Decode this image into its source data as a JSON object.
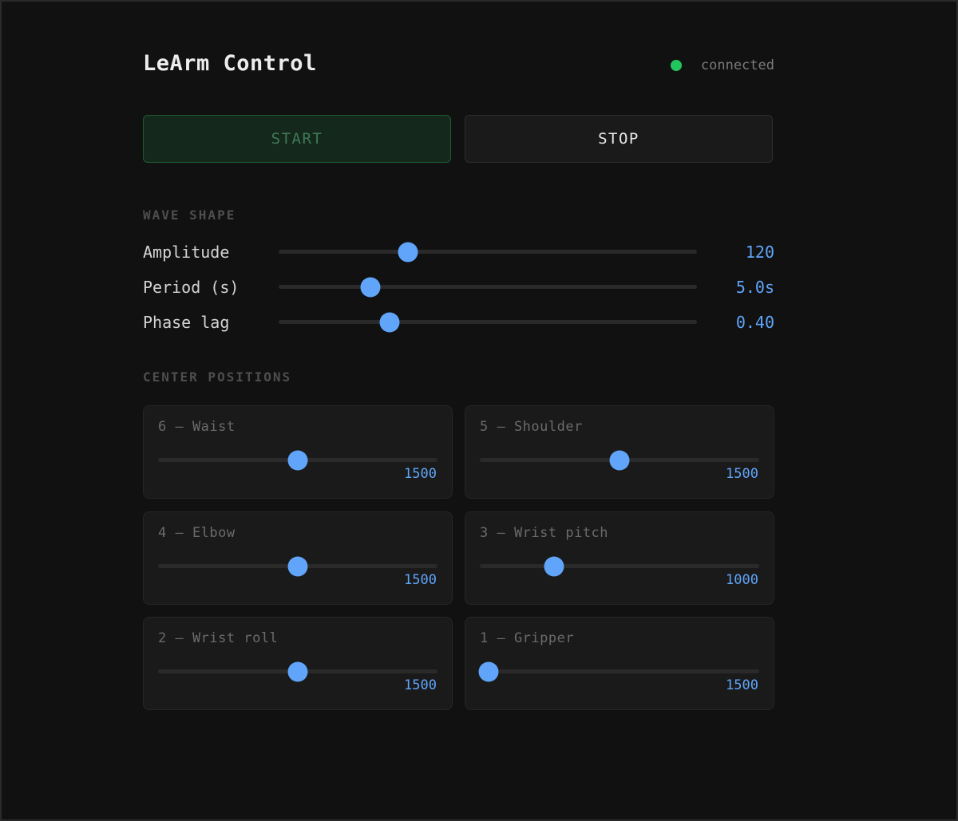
{
  "header": {
    "title": "LeArm Control",
    "status_text": "connected",
    "status_color": "#22c55e"
  },
  "controls": {
    "start_label": "START",
    "stop_label": "STOP"
  },
  "wave_shape": {
    "section_label": "WAVE SHAPE",
    "params": [
      {
        "label": "Amplitude",
        "value": "120",
        "fill_fraction": 0.31
      },
      {
        "label": "Period (s)",
        "value": "5.0s",
        "fill_fraction": 0.22
      },
      {
        "label": "Phase lag",
        "value": "0.40",
        "fill_fraction": 0.265
      }
    ]
  },
  "center_positions": {
    "section_label": "CENTER POSITIONS",
    "servos": [
      {
        "label": "6 — Waist",
        "value": "1500",
        "fill_fraction": 0.5
      },
      {
        "label": "5 — Shoulder",
        "value": "1500",
        "fill_fraction": 0.5
      },
      {
        "label": "4 — Elbow",
        "value": "1500",
        "fill_fraction": 0.5
      },
      {
        "label": "3 — Wrist pitch",
        "value": "1000",
        "fill_fraction": 0.267
      },
      {
        "label": "2 — Wrist roll",
        "value": "1500",
        "fill_fraction": 0.5
      },
      {
        "label": "1 — Gripper",
        "value": "1500",
        "fill_fraction": 0.03
      }
    ]
  },
  "colors": {
    "accent": "#60a5fa",
    "background": "#111111",
    "card": "#1a1a1a"
  }
}
